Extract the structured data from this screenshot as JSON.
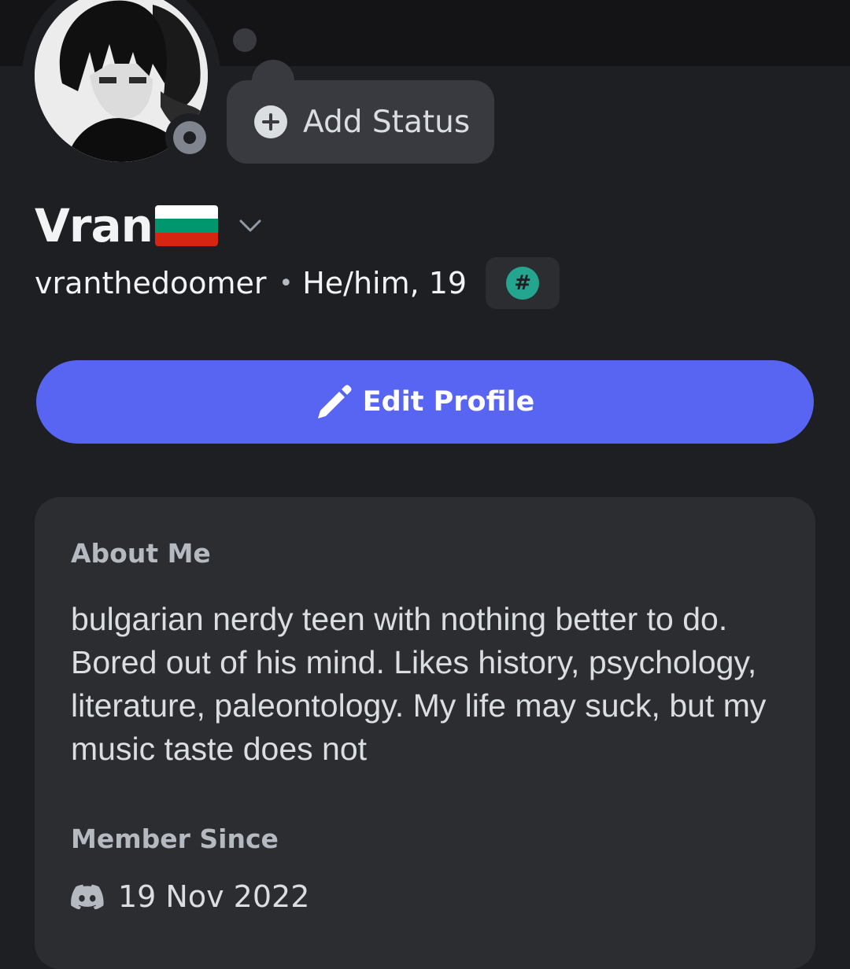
{
  "profile": {
    "display_name": "Vran",
    "username": "vranthedoomer",
    "pronouns": "He/him, 19",
    "separator": "•",
    "tag_symbol": "#",
    "flag_colors": [
      "#ffffff",
      "#00966e",
      "#d62612"
    ]
  },
  "status": {
    "add_label": "Add Status",
    "presence": "offline"
  },
  "actions": {
    "edit_profile_label": "Edit Profile"
  },
  "about": {
    "title": "About Me",
    "bio": "bulgarian nerdy teen with nothing better to do. Bored out of his mind. Likes history, psychology, literature, paleontology. My life may suck, but my music taste does not"
  },
  "member_since": {
    "title": "Member Since",
    "date": "19 Nov 2022",
    "icon": "discord-icon"
  },
  "colors": {
    "accent": "#5865f2",
    "background": "#1e1f22",
    "card": "#2b2d31",
    "offline": "#80848e",
    "tag_badge": "#23a58f"
  }
}
